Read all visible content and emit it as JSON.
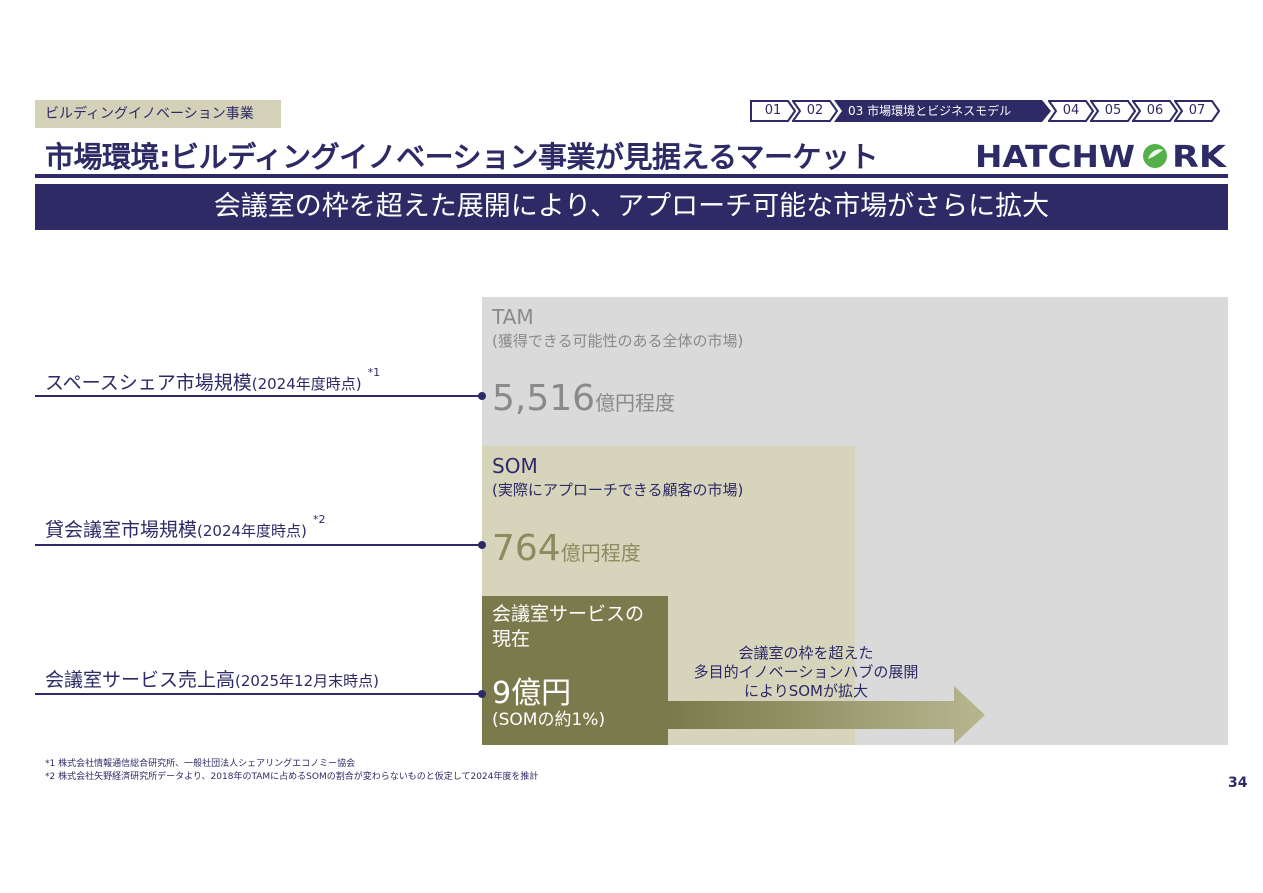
{
  "header": {
    "category_tag": "ビルディングイノベーション事業",
    "title": "市場環境:ビルディングイノベーション事業が見据えるマーケット",
    "banner": "会議室の枠を超えた展開により、アプローチ可能な市場がさらに拡大",
    "logo_text": "HATCHWORK"
  },
  "nav": {
    "items": [
      "01",
      "02",
      "03  市場環境とビジネスモデル",
      "04",
      "05",
      "06",
      "07"
    ],
    "active_index": 2
  },
  "diagram": {
    "tam": {
      "label": "TAM",
      "sub": "(獲得できる可能性のある全体の市場)",
      "value": "5,516",
      "unit": "億円程度"
    },
    "som": {
      "label": "SOM",
      "sub": "(実際にアプローチできる顧客の市場)",
      "value": "764",
      "unit": "億円程度"
    },
    "current": {
      "label": "会議室サービスの現在",
      "value": "9億円",
      "note": "(SOMの約1%)"
    },
    "arrow_text": [
      "会議室の枠を超えた",
      "多目的イノベーションハブの展開",
      "によりSOMが拡大"
    ],
    "rows": [
      {
        "main": "スペースシェア市場規模",
        "paren": "(2024年度時点)",
        "sup": "*1"
      },
      {
        "main": "貸会議室市場規模",
        "paren": "(2024年度時点)",
        "sup": "*2"
      },
      {
        "main": "会議室サービス売上高",
        "paren": "(2025年12月末時点)",
        "sup": ""
      }
    ]
  },
  "footnotes": [
    "*1 株式会社情報通信総合研究所、一般社団法人シェアリングエコノミー協会",
    "*2 株式会社矢野経済研究所データより、2018年のTAMに占めるSOMの割合が変わらないものと仮定して2024年度を推計"
  ],
  "page_number": "34",
  "colors": {
    "navy": "#2d2a66",
    "tam_gray": "#dadada",
    "som_khaki": "#d6d5bc",
    "current_olive": "#7a7a4c",
    "logo_green": "#55b04a"
  }
}
